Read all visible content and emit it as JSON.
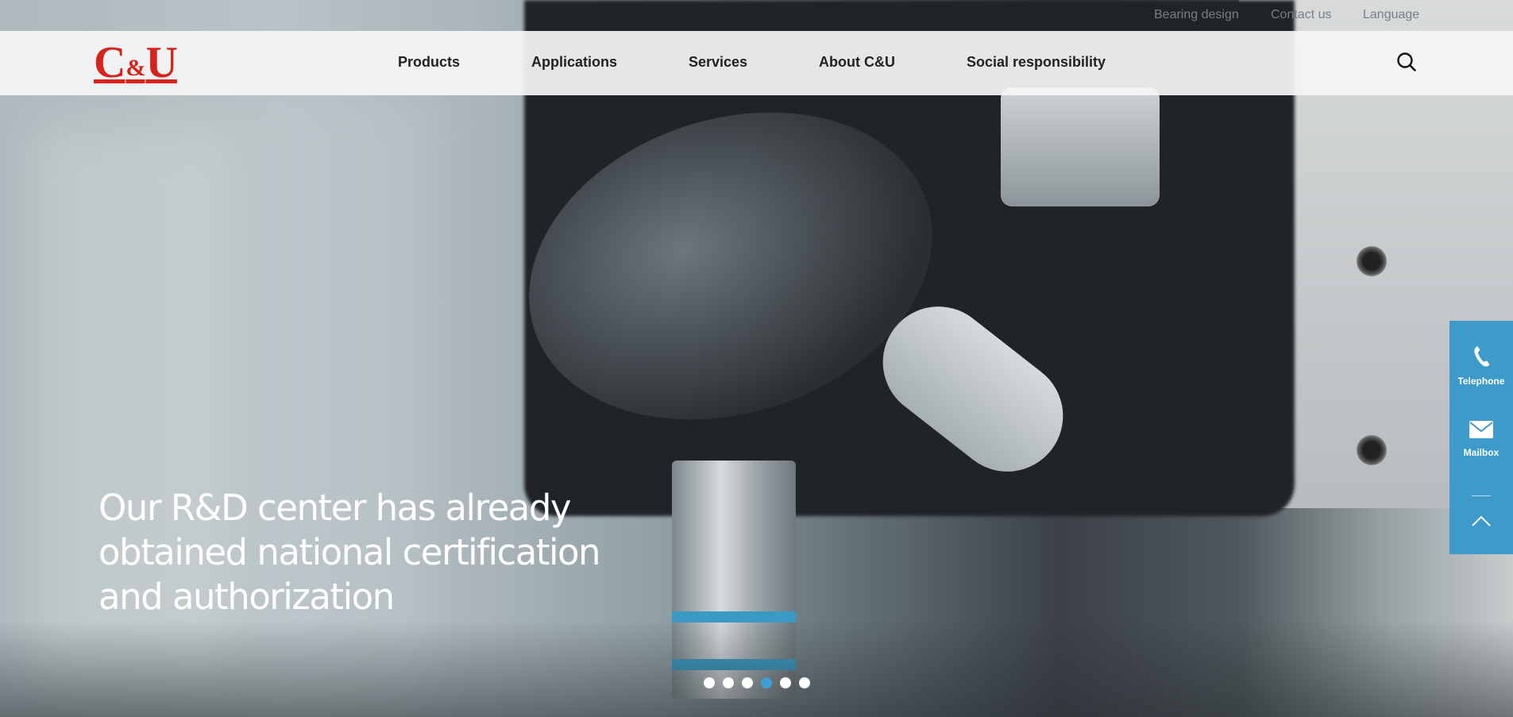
{
  "utility": {
    "bearing_design": "Bearing design",
    "contact_us": "Contact us",
    "language": "Language"
  },
  "logo": {
    "left": "C",
    "amp": "&",
    "right": "U"
  },
  "nav": {
    "items": [
      "Products",
      "Applications",
      "Services",
      "About C&U",
      "Social responsibility"
    ]
  },
  "search": {
    "icon": "search-icon"
  },
  "hero": {
    "caption_line1": "Our R&D center has already",
    "caption_line2": "obtained national certification",
    "caption_line3": "and authorization"
  },
  "carousel": {
    "slide_count": 6,
    "active_index": 3
  },
  "sidepanel": {
    "telephone_label": "Telephone",
    "mailbox_label": "Mailbox",
    "telephone_icon": "phone-icon",
    "mailbox_icon": "mail-icon",
    "top_icon": "chevron-up-icon"
  },
  "colors": {
    "brand_red": "#d8231c",
    "accent_blue": "#3d9ac9",
    "dot_active": "#3aa0d6"
  }
}
